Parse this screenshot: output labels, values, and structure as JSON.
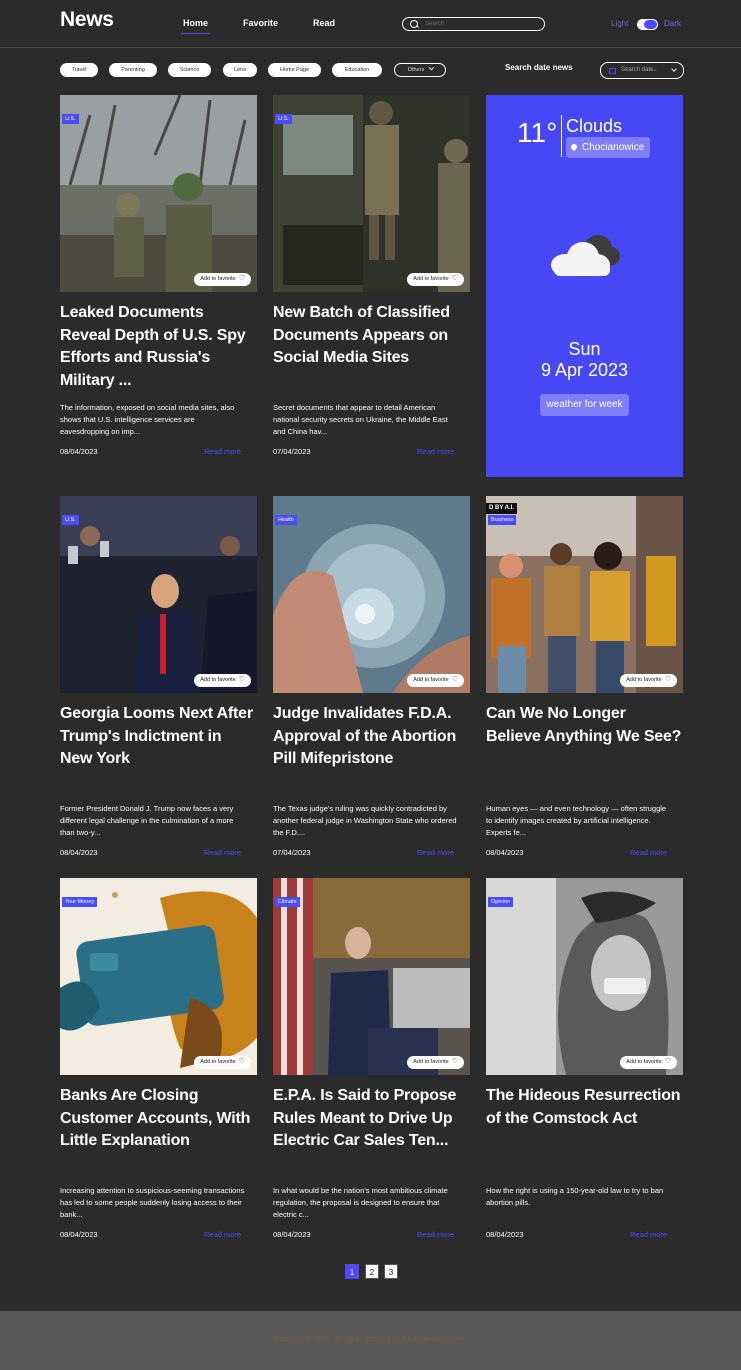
{
  "header": {
    "logo": "News",
    "nav": [
      "Home",
      "Favorite",
      "Read"
    ],
    "search_placeholder": "Search",
    "theme_light": "Light",
    "theme_dark": "Dark"
  },
  "filters": {
    "chips": [
      "Travel",
      "Parenting",
      "Science",
      "Lens",
      "Home Page",
      "Education"
    ],
    "others": "Others",
    "date_label": "Search date news",
    "date_placeholder": "Search date.."
  },
  "weather": {
    "temp": "11°",
    "condition": "Clouds",
    "location": "Chocianowice",
    "day": "Sun",
    "date": "9 Apr 2023",
    "button": "weather for week"
  },
  "fav_label": "Add to favorite",
  "more_label": "Read more",
  "articles": [
    {
      "badge": "U.S.",
      "title": "Leaked Documents Reveal Depth of U.S. Spy Efforts and Russia's Military ...",
      "desc": "The information, exposed on social media sites, also shows that U.S. intelligence services are eavesdropping on imp...",
      "date": "08/04/2023"
    },
    {
      "badge": "U.S.",
      "title": "New Batch of Classified Documents Appears on Social Media Sites",
      "desc": "Secret documents that appear to detail American national security secrets on Ukraine, the Middle East and China hav...",
      "date": "07/04/2023"
    },
    {
      "badge": "U.S.",
      "title": "Georgia Looms Next After Trump's Indictment in New York",
      "desc": "Former President Donald J. Trump now faces a very different legal challenge in the culmination of a more than two-y...",
      "date": "08/04/2023"
    },
    {
      "badge": "Health",
      "title": "Judge Invalidates F.D.A. Approval of the Abortion Pill Mifepristone",
      "desc": "The Texas judge's ruling was quickly contradicted by another federal judge in Washington State who ordered the F.D....",
      "date": "07/04/2023"
    },
    {
      "badge": "Business",
      "title": "Can We No Longer Believe Anything We See?",
      "desc": "Human eyes — and even technology — often struggle to identify images created by artificial intelligence. Experts fe...",
      "date": "08/04/2023",
      "overlay": "D BY A.I."
    },
    {
      "badge": "Your Money",
      "title": "Banks Are Closing Customer Accounts, With Little Explanation",
      "desc": "Increasing attention to suspicious-seeming transactions has led to some people suddenly losing access to their bank...",
      "date": "08/04/2023"
    },
    {
      "badge": "Climate",
      "title": "E.P.A. Is Said to Propose Rules Meant to Drive Up Electric Car Sales Ten...",
      "desc": "In what would be the nation's most ambitious climate regulation, the proposal is designed to ensure that electric c...",
      "date": "08/04/2023"
    },
    {
      "badge": "Opinion",
      "title": "The Hideous Resurrection of the Comstock Act",
      "desc": "How the right is using a 150-year-old law to try to ban abortion pills.",
      "date": "08/04/2023"
    }
  ],
  "pagination": [
    "1",
    "2",
    "3"
  ],
  "footer": "Copyright © 2023 · All rights reserved by the News Application"
}
